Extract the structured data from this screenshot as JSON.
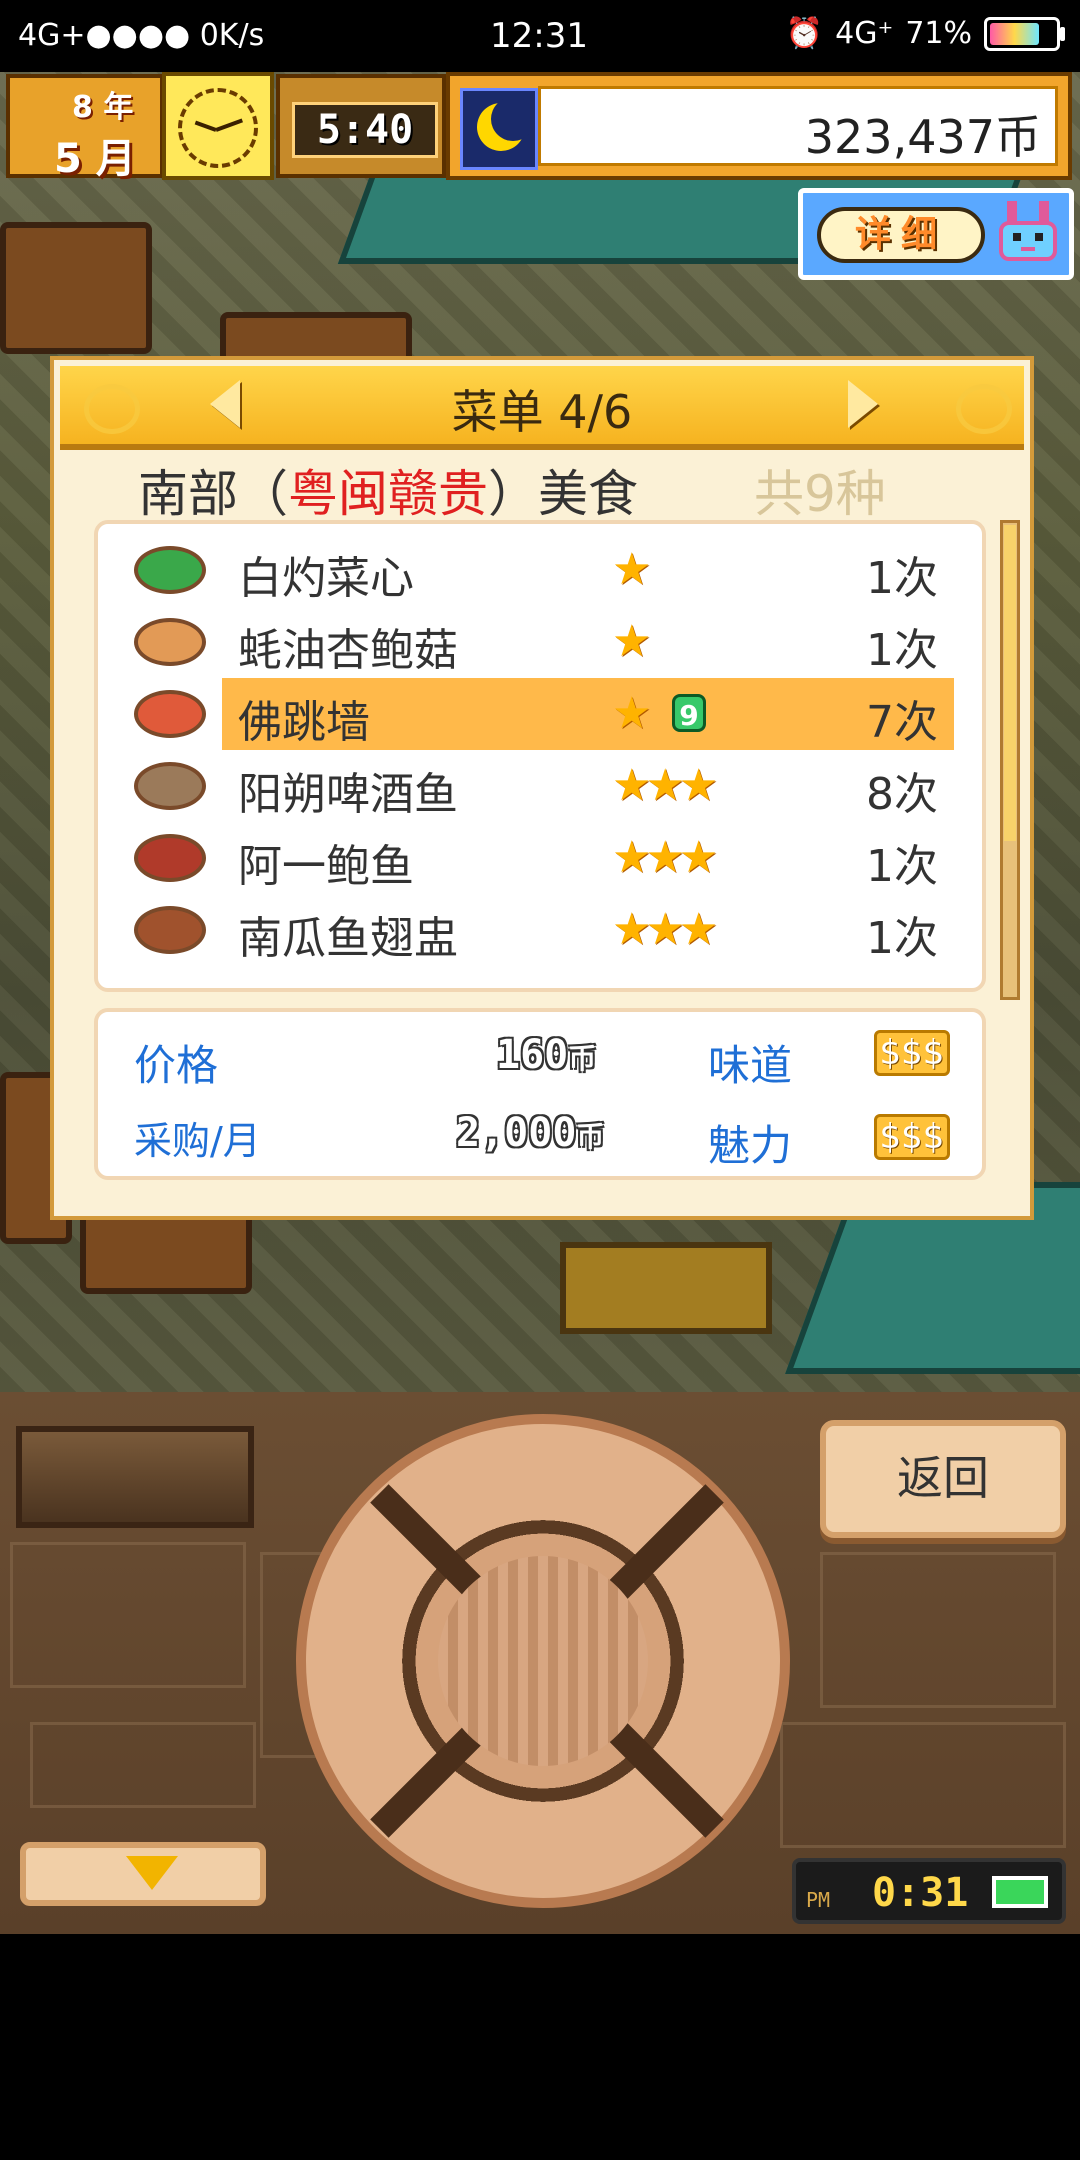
{
  "status_bar": {
    "left": "4G+●●●● 0K/s",
    "time": "12:31",
    "network": "4G⁺",
    "battery": "71%"
  },
  "hud": {
    "year_label": "8 年",
    "month_label": "5 月",
    "game_time": "5:40",
    "money": "323,437币",
    "detail_button": "详细"
  },
  "menu": {
    "title": "菜单 4/6",
    "region_prefix": "南部（",
    "region_highlight": "粤闽赣贵",
    "region_suffix": "）美食",
    "count": "共9种",
    "items": [
      {
        "name": "白灼菜心",
        "stars": "★",
        "badge": "",
        "times": "1次",
        "icon_color": "#3aa84a"
      },
      {
        "name": "蚝油杏鲍菇",
        "stars": "★",
        "badge": "",
        "times": "1次",
        "icon_color": "#e29a56"
      },
      {
        "name": "佛跳墙",
        "stars": "★",
        "badge": "9",
        "times": "7次",
        "icon_color": "#e05a3a"
      },
      {
        "name": "阳朔啤酒鱼",
        "stars": "★★★",
        "badge": "",
        "times": "8次",
        "icon_color": "#9b7a5a"
      },
      {
        "name": "阿一鲍鱼",
        "stars": "★★★",
        "badge": "",
        "times": "1次",
        "icon_color": "#b03a2a"
      },
      {
        "name": "南瓜鱼翅盅",
        "stars": "★★★",
        "badge": "",
        "times": "1次",
        "icon_color": "#a0522d"
      }
    ],
    "selected_index": 2,
    "info": {
      "price_label": "价格",
      "price_value": "160",
      "price_unit": "币",
      "purchase_label": "采购/月",
      "purchase_value": "2,000",
      "purchase_unit": "币",
      "taste_label": "味道",
      "taste_rating": "$$$",
      "charm_label": "魅力",
      "charm_rating": "$$$"
    }
  },
  "controls": {
    "back_button": "返回",
    "pm_label": "PM",
    "pm_time": "0:31"
  }
}
